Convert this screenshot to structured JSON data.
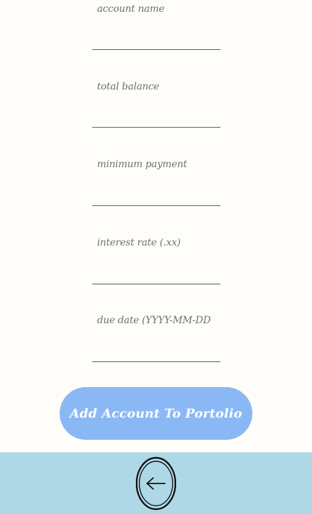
{
  "form": {
    "fields": [
      {
        "label": "account name",
        "value": ""
      },
      {
        "label": "total balance",
        "value": ""
      },
      {
        "label": "minimum payment",
        "value": ""
      },
      {
        "label": "interest rate (.xx)",
        "value": ""
      },
      {
        "label": "due date (YYYY-MM-DD",
        "value": ""
      }
    ],
    "submit_label": "Add Account To Portolio"
  },
  "nav": {
    "back_icon": "arrow-left-icon"
  },
  "colors": {
    "background": "#fefdf9",
    "button": "#8ab8f4",
    "bottom_bar": "#aed8e6"
  }
}
